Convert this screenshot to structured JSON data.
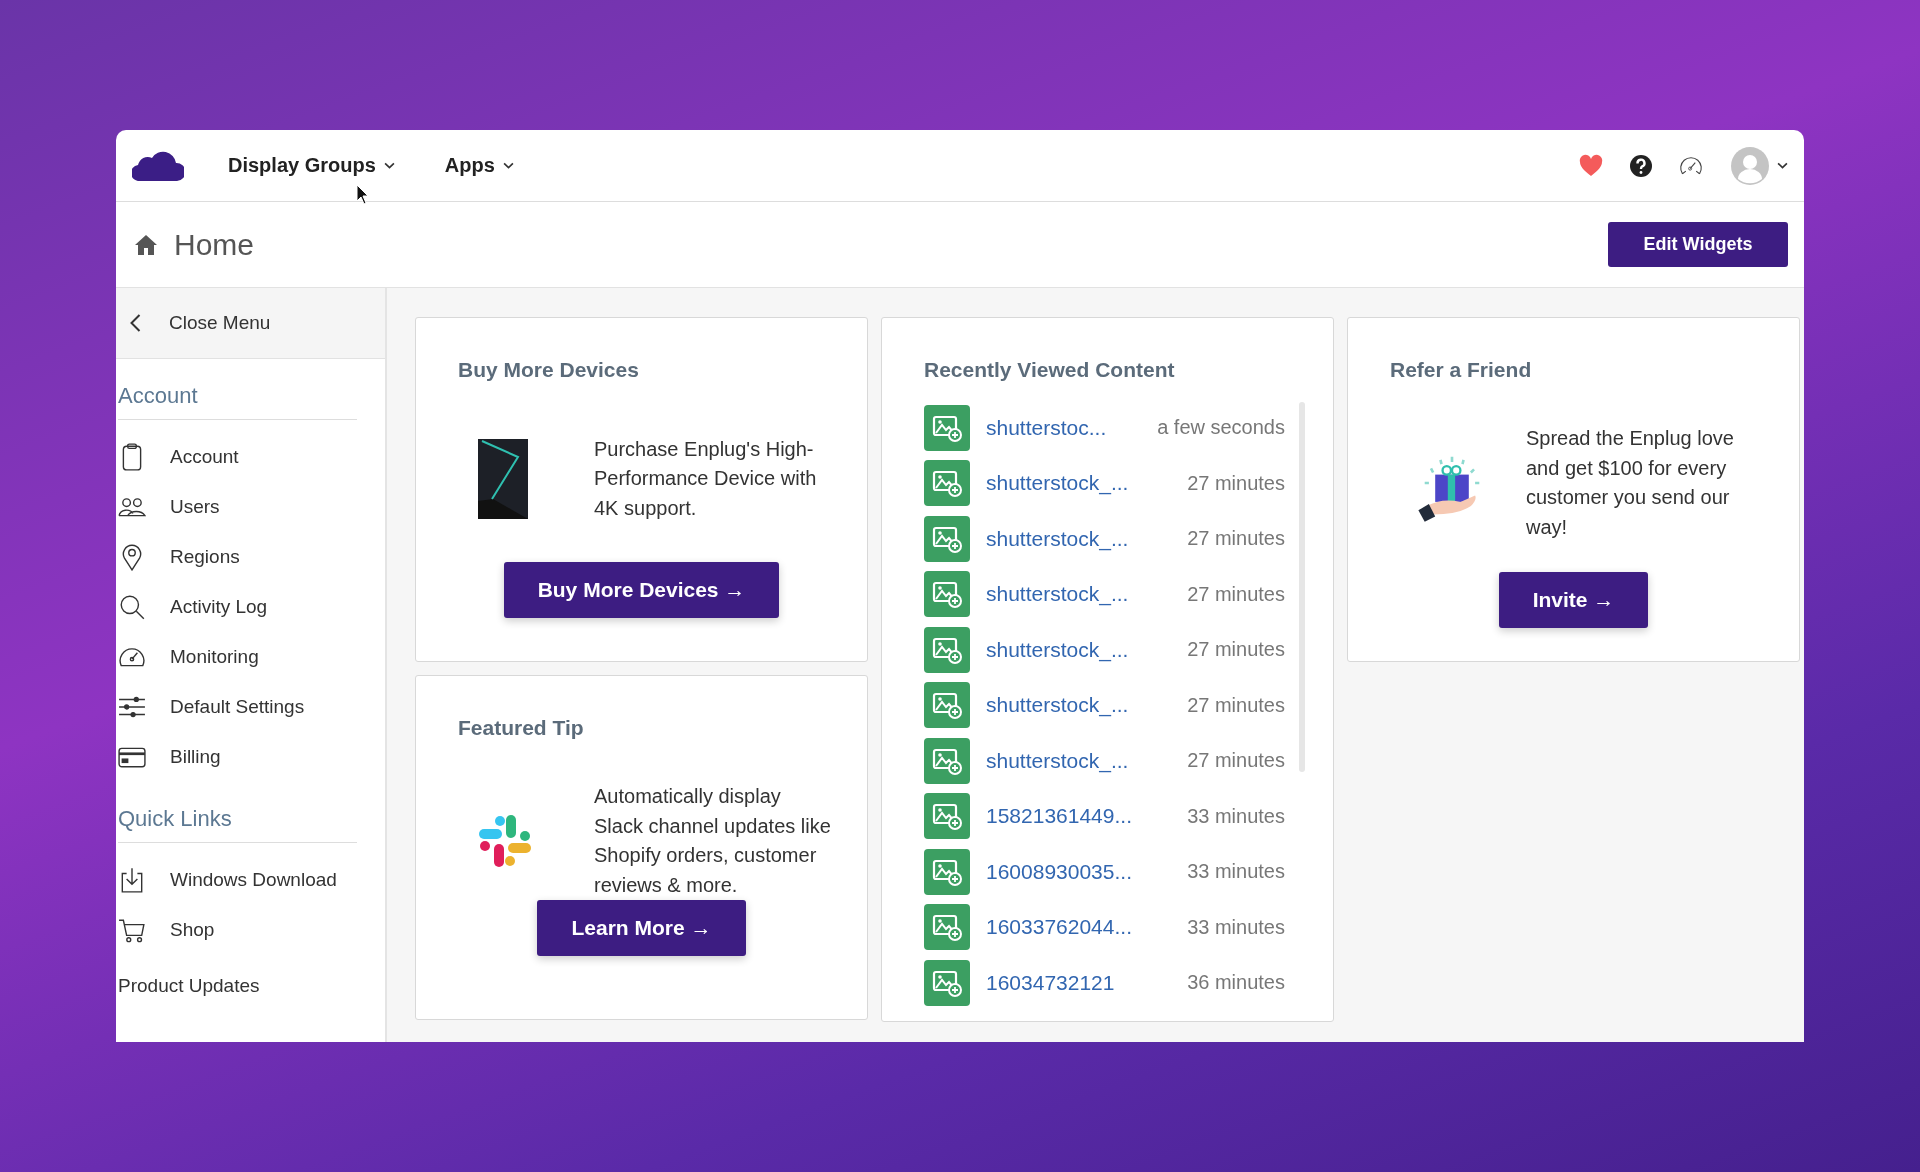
{
  "nav": {
    "menus": [
      {
        "label": "Display Groups"
      },
      {
        "label": "Apps"
      }
    ]
  },
  "header": {
    "title": "Home",
    "button": "Edit Widgets"
  },
  "sidebar": {
    "close": "Close Menu",
    "sections": [
      {
        "title": "Account",
        "items": [
          {
            "label": "Account",
            "kind": "clipboard"
          },
          {
            "label": "Users",
            "kind": "users"
          },
          {
            "label": "Regions",
            "kind": "pin"
          },
          {
            "label": "Activity Log",
            "kind": "search"
          },
          {
            "label": "Monitoring",
            "kind": "gauge"
          },
          {
            "label": "Default Settings",
            "kind": "sliders"
          },
          {
            "label": "Billing",
            "kind": "card"
          }
        ]
      },
      {
        "title": "Quick Links",
        "items": [
          {
            "label": "Windows Download",
            "kind": "download"
          },
          {
            "label": "Shop",
            "kind": "cart"
          }
        ]
      }
    ],
    "footer": "Product Updates"
  },
  "widgets": {
    "buy": {
      "title": "Buy More Devices",
      "text": "Purchase Enplug's High-Performance Device with 4K support.",
      "button": "Buy More Devices →"
    },
    "tip": {
      "title": "Featured Tip",
      "text": "Automatically display Slack channel updates like Shopify orders, customer reviews & more.",
      "button": "Learn More →"
    },
    "recent": {
      "title": "Recently Viewed Content",
      "items": [
        {
          "name": "shutterstoc...",
          "time": "a few seconds"
        },
        {
          "name": "shutterstock_...",
          "time": "27 minutes"
        },
        {
          "name": "shutterstock_...",
          "time": "27 minutes"
        },
        {
          "name": "shutterstock_...",
          "time": "27 minutes"
        },
        {
          "name": "shutterstock_...",
          "time": "27 minutes"
        },
        {
          "name": "shutterstock_...",
          "time": "27 minutes"
        },
        {
          "name": "shutterstock_...",
          "time": "27 minutes"
        },
        {
          "name": "15821361449...",
          "time": "33 minutes"
        },
        {
          "name": "16008930035...",
          "time": "33 minutes"
        },
        {
          "name": "16033762044...",
          "time": "33 minutes"
        },
        {
          "name": "16034732121",
          "time": "36 minutes"
        }
      ]
    },
    "refer": {
      "title": "Refer a Friend",
      "text": "Spread the Enplug love and get $100 for every customer you send our way!",
      "button": "Invite →"
    }
  }
}
